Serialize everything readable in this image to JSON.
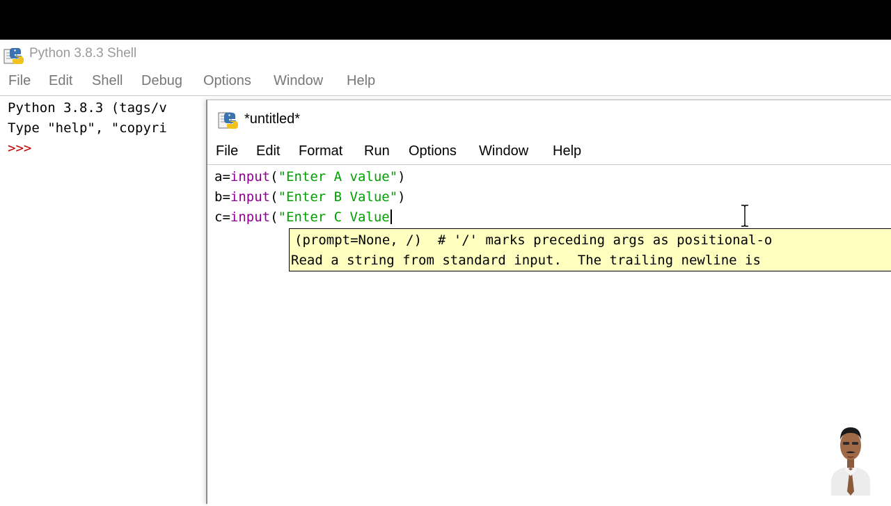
{
  "shell": {
    "title": "Python 3.8.3 Shell",
    "menu": [
      "File",
      "Edit",
      "Shell",
      "Debug",
      "Options",
      "Window",
      "Help"
    ],
    "lines": [
      "Python 3.8.3 (tags/v",
      "Type \"help\", \"copyri"
    ],
    "prompt": ">>>"
  },
  "editor": {
    "title": "*untitled*",
    "menu": [
      "File",
      "Edit",
      "Format",
      "Run",
      "Options",
      "Window",
      "Help"
    ],
    "code": [
      {
        "var": "a",
        "op": "=",
        "fn": "input",
        "open": "(",
        "str": "\"Enter A value\"",
        "close": ")"
      },
      {
        "var": "b",
        "op": "=",
        "fn": "input",
        "open": "(",
        "str": "\"Enter B Value\"",
        "close": ")"
      },
      {
        "var": "c",
        "op": "=",
        "fn": "input",
        "open": "(",
        "str": "\"Enter C Value",
        "close": ""
      }
    ],
    "calltip": {
      "line1": "(prompt=None, /)  # '/' marks preceding args as positional-o",
      "line2": "Read a string from standard input.  The trailing newline is"
    }
  },
  "colors": {
    "keyword_builtin": "#900090",
    "string": "#00a000",
    "prompt": "#c00000",
    "calltip_bg": "#ffffc0"
  }
}
